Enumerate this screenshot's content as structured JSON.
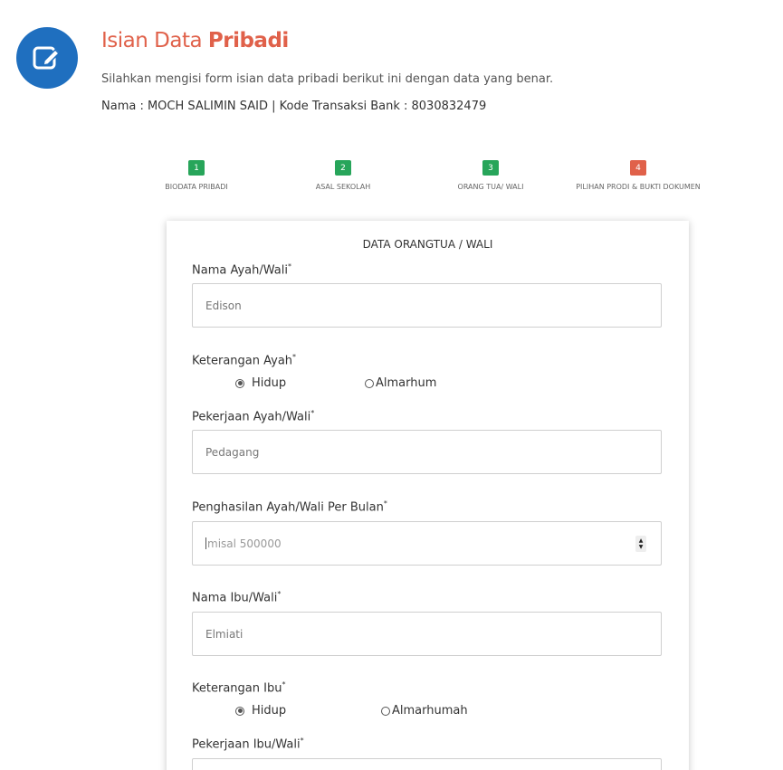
{
  "header": {
    "icon": "edit-icon",
    "title_light": "Isian Data",
    "title_bold": "Pribadi",
    "subtitle": "Silahkan mengisi form isian data pribadi berikut ini dengan data yang benar.",
    "info": "Nama : MOCH SALIMIN SAID | Kode Transaksi Bank : 8030832479"
  },
  "steps": [
    {
      "number": "1",
      "label": "BIODATA PRIBADI",
      "state": "done"
    },
    {
      "number": "2",
      "label": "ASAL SEKOLAH",
      "state": "done"
    },
    {
      "number": "3",
      "label": "ORANG TUA/ WALI",
      "state": "done"
    },
    {
      "number": "4",
      "label": "PILIHAN PRODI & BUKTI DOKUMEN",
      "state": "active"
    }
  ],
  "form": {
    "title": "DATA ORANGTUA / WALI",
    "required_mark": "*",
    "nama_ayah": {
      "label": "Nama Ayah/Wali",
      "value": "Edison"
    },
    "keterangan_ayah": {
      "label": "Keterangan Ayah",
      "options": [
        "Hidup",
        "Almarhum"
      ],
      "selected": "Hidup"
    },
    "pekerjaan_ayah": {
      "label": "Pekerjaan Ayah/Wali",
      "value": "Pedagang"
    },
    "penghasilan_ayah": {
      "label": "Penghasilan Ayah/Wali Per Bulan",
      "placeholder": "misal 500000"
    },
    "nama_ibu": {
      "label": "Nama Ibu/Wali",
      "value": "Elmiati"
    },
    "keterangan_ibu": {
      "label": "Keterangan Ibu",
      "options": [
        "Hidup",
        "Almarhumah"
      ],
      "selected": "Hidup"
    },
    "pekerjaan_ibu": {
      "label": "Pekerjaan Ibu/Wali",
      "value": ""
    }
  },
  "colors": {
    "accent": "#e0614a",
    "brand_blue": "#1f6fbf",
    "step_done": "#27a55a",
    "step_active": "#e0614a"
  }
}
